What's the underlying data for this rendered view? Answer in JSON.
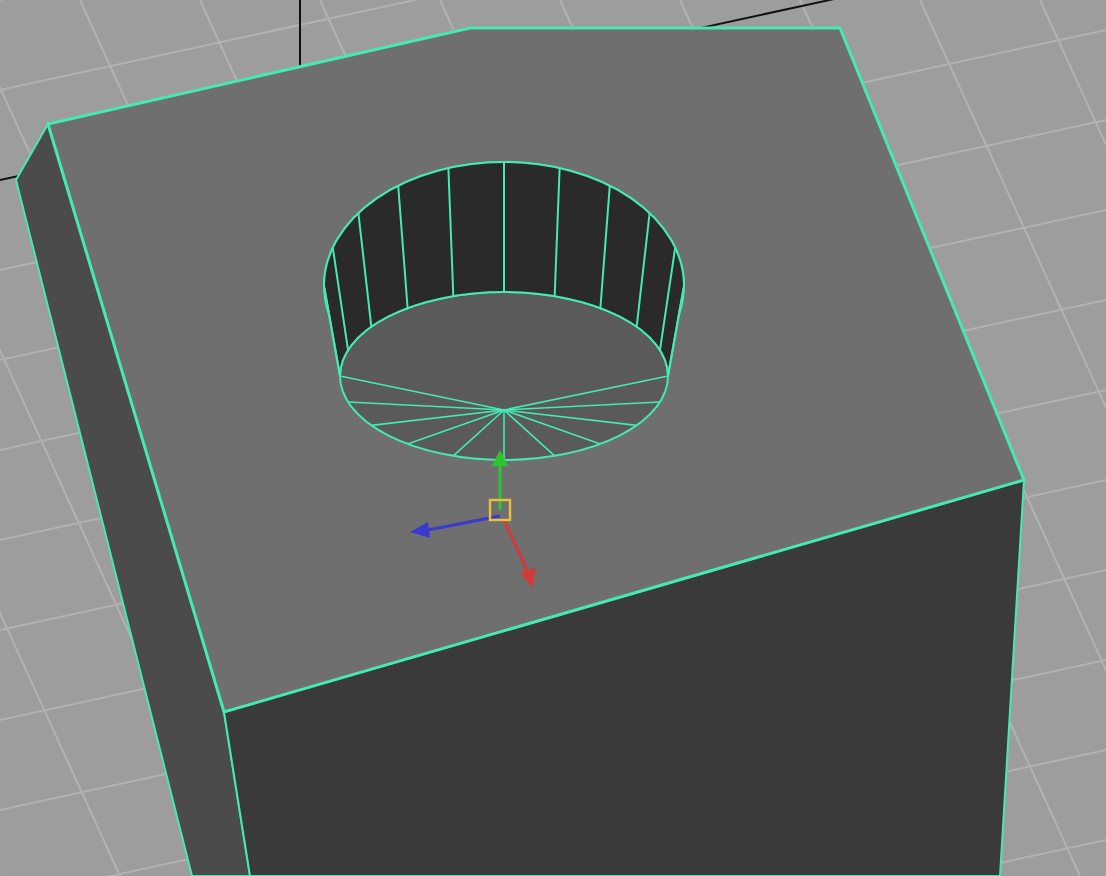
{
  "viewport": {
    "mesh": {
      "selected": true
    },
    "manipulator": {
      "visible": true
    }
  }
}
